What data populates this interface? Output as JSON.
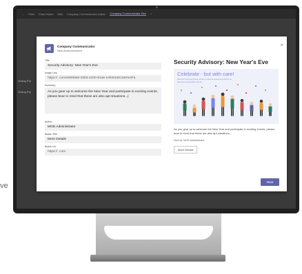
{
  "background": {
    "partial_label": "ve"
  },
  "teams": {
    "tabs": [
      "...",
      "Files",
      "Class Notes",
      "Wiki",
      "Company Communicator Admin",
      "Company Communicator Dev",
      "+"
    ],
    "active_tab_index": 5,
    "sidebar": {
      "item_1": "Outing Pla",
      "item_2": "Outing Pla"
    }
  },
  "dialog": {
    "app_name": "Company Communicator",
    "app_subtitle": "New Announcement",
    "form": {
      "title_label": "Title",
      "title_value": "Security Advisory: New Year's Eve",
      "image_url_label": "Image Link",
      "image_url_value": "https://          .com/e8009a0-0353-4200-81a6-1efe53a0c2a0%2Fa",
      "summary_label": "Summary",
      "summary_value": "As you gear up to welcome the New Year and participate in exciting events, please bear in mind that these are also apt situations...|",
      "author_label": "Author",
      "author_value": "MOD Administrator",
      "button_title_label": "Button Title",
      "button_title_value": "More Details",
      "button_url_label": "Button Url",
      "button_url_value": "https://          .com"
    },
    "preview": {
      "title": "Security Advisory: New Year's Eve",
      "hero_heading": "Celebrate - but with care!",
      "hero_subtext": "Have fun but keep these points in mind for welcoming 2019 in a safe and responsible manner",
      "summary": "As you gear up to welcome the New Year and participate in exciting events, please bear in mind that these are also apt situations...",
      "author": "Sent by: MOD Administrator",
      "button_label": "More Details"
    },
    "next_label": "Next",
    "close_glyph": "×"
  },
  "colors": {
    "brand": "#6264a7",
    "accent": "#7b83eb",
    "field_bg": "#f0f0f0"
  }
}
